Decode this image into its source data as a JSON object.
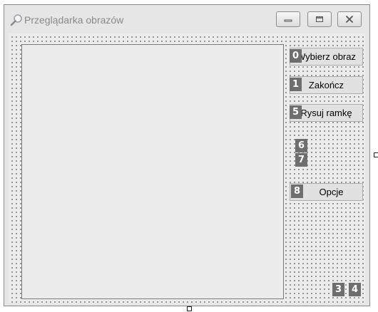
{
  "window": {
    "title": "Przeglądarka obrazów",
    "controls": {
      "minimize": "minimize",
      "maximize": "maximize",
      "close": "close"
    }
  },
  "buttons": {
    "choose_image": "Wybierz obraz",
    "quit": "Zakończ",
    "draw_frame": "Rysuj ramkę",
    "options": "Opcje"
  },
  "tab_order": {
    "choose_image": "0",
    "quit": "1",
    "draw_frame": "5",
    "c6": "6",
    "c7": "7",
    "options": "8",
    "c3": "3",
    "c4": "4"
  },
  "colors": {
    "badge": "#6e6e6e",
    "grid_dots": "#5a5a5a",
    "form_bg": "#ececec"
  },
  "icons": {
    "app": "magnifier-icon"
  }
}
